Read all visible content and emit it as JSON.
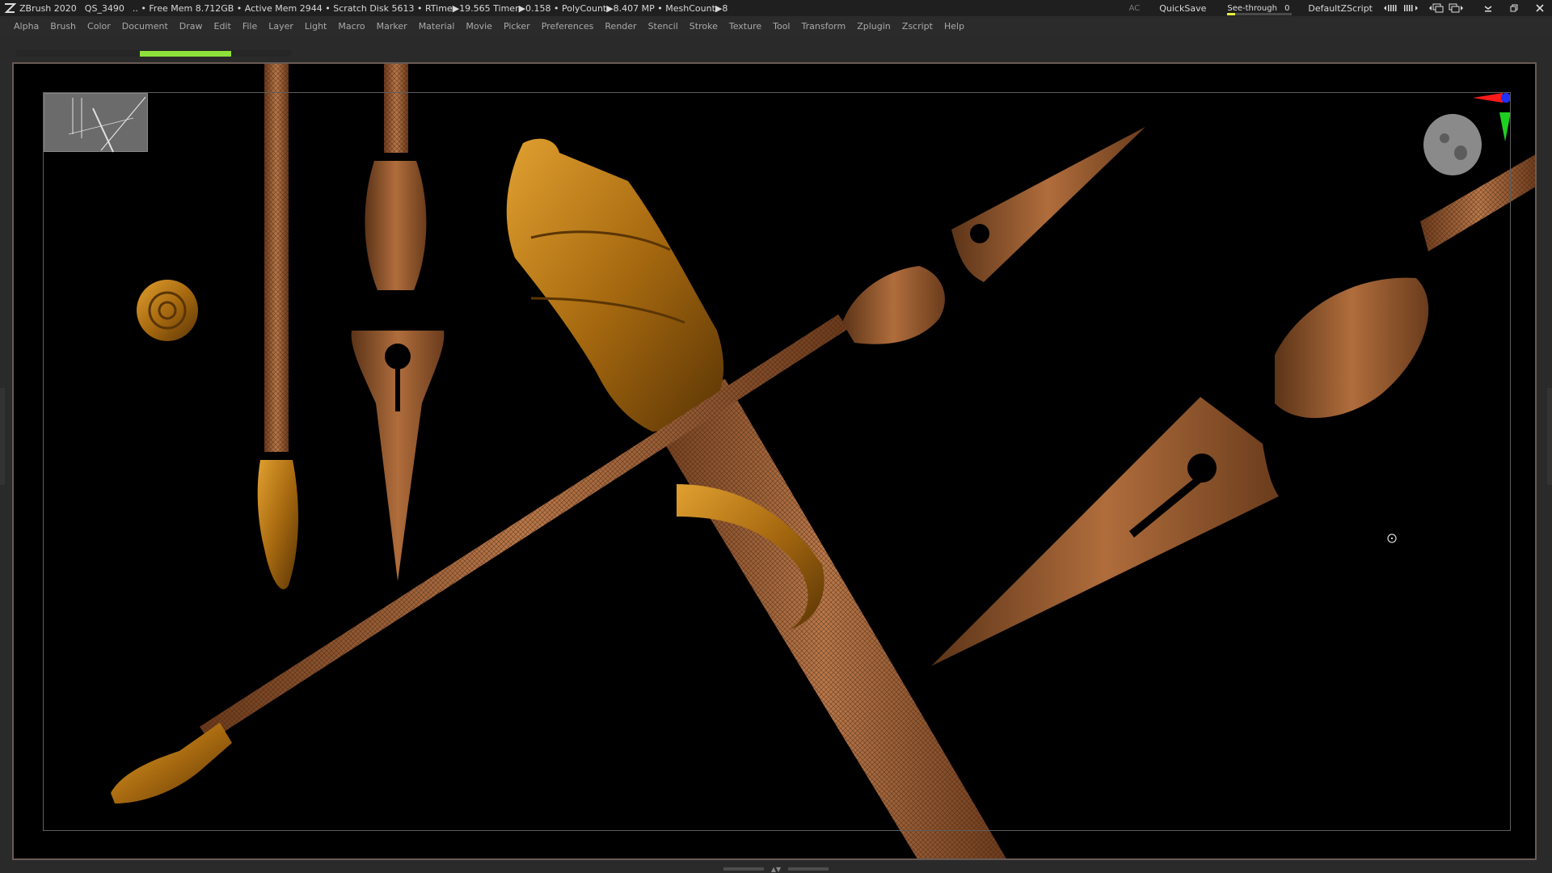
{
  "titlebar": {
    "app": "ZBrush 2020",
    "doc": "QS_3490",
    "stats": ".. • Free Mem 8.712GB • Active Mem 2944 • Scratch Disk 5613 •  RTime▶19.565 Timer▶0.158 • PolyCount▶8.407 MP  • MeshCount▶8",
    "ac": "AC",
    "quicksave": "QuickSave",
    "seethrough_label": "See-through",
    "seethrough_value": "0",
    "seethrough_fraction": 0,
    "script": "DefaultZScript"
  },
  "menu": [
    "Alpha",
    "Brush",
    "Color",
    "Document",
    "Draw",
    "Edit",
    "File",
    "Layer",
    "Light",
    "Macro",
    "Marker",
    "Material",
    "Movie",
    "Picker",
    "Preferences",
    "Render",
    "Stencil",
    "Stroke",
    "Texture",
    "Tool",
    "Transform",
    "Zplugin",
    "Zscript",
    "Help"
  ],
  "progress": {
    "fraction": 0.33,
    "color": "#8ee13a"
  },
  "colors": {
    "canvas_bg": "#000000",
    "frame_border": "#6a5a55",
    "gold": "#b87a1e",
    "copper": "#a4643a",
    "axis_x": "#ff1a1a",
    "axis_y": "#20d020",
    "axis_z": "#2030ff"
  },
  "icons": {
    "app": "zbrush-logo-icon",
    "gizmo_head": "navigation-head-icon",
    "cursor": "brush-cursor-icon"
  }
}
